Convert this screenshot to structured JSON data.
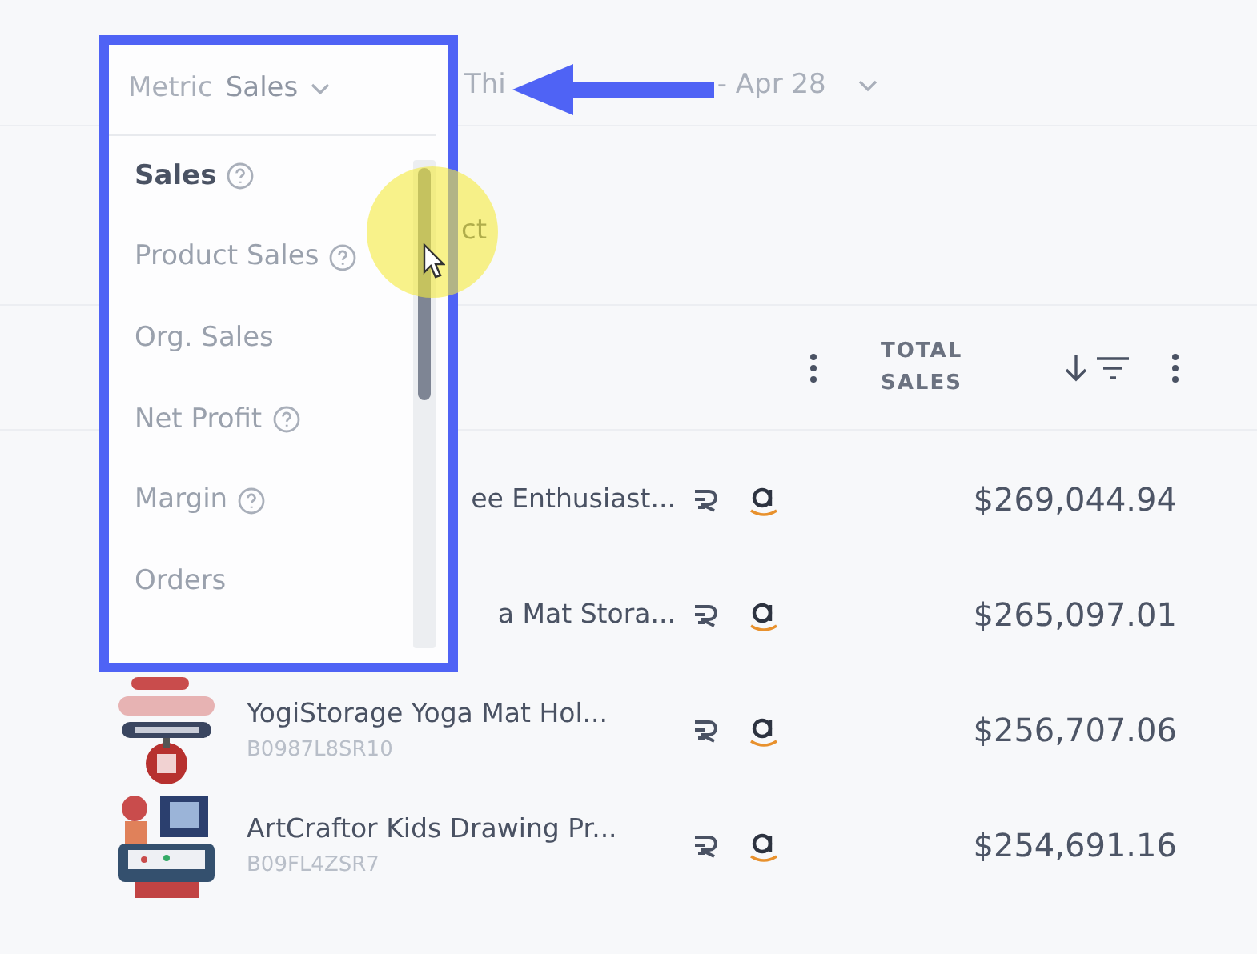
{
  "metric_selector": {
    "label": "Metric",
    "value": "Sales",
    "expanded": true
  },
  "metric_options": [
    {
      "label": "Sales",
      "help": true,
      "selected": true
    },
    {
      "label": "Product Sales",
      "help": true,
      "selected": false
    },
    {
      "label": "Org. Sales",
      "help": false,
      "selected": false
    },
    {
      "label": "Net Profit",
      "help": true,
      "selected": false
    },
    {
      "label": "Margin",
      "help": true,
      "selected": false
    },
    {
      "label": "Orders",
      "help": false,
      "selected": false
    }
  ],
  "date_range": {
    "text_start": "Thi",
    "text_end": "- Apr 28"
  },
  "search": {
    "text": "ct"
  },
  "table": {
    "columns": [
      {
        "label": "TOTAL SALES",
        "sorted": true
      }
    ],
    "rows": [
      {
        "name": "ee Enthusiast...",
        "price": "$269,044.94",
        "partly_hidden": true
      },
      {
        "name": "a Mat Stora...",
        "price": "$265,097.01",
        "partly_hidden": true
      },
      {
        "name": "YogiStorage Yoga Mat Hol...",
        "sku": "B0987L8SR10",
        "price": "$256,707.06",
        "partly_hidden": false
      },
      {
        "name": "ArtCraftor Kids Drawing Pr...",
        "sku": "B09FL4ZSR7",
        "price": "$254,691.16",
        "partly_hidden": false
      }
    ]
  },
  "annotations": [
    {
      "kind": "box"
    },
    {
      "kind": "arrow"
    },
    {
      "kind": "highlight"
    },
    {
      "kind": "cursor"
    }
  ]
}
